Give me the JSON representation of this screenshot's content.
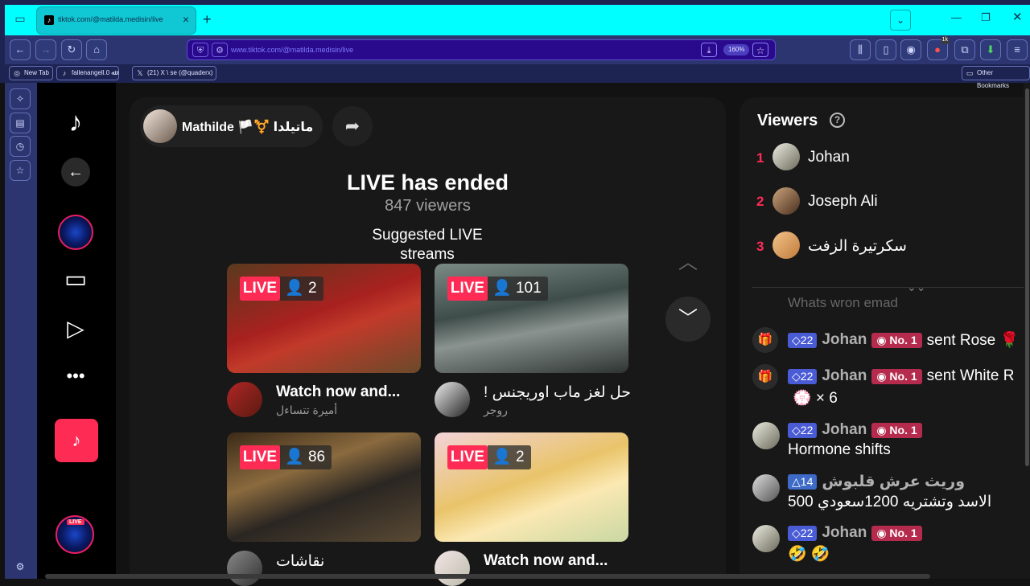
{
  "browser": {
    "tab_title": "tiktok.com/@matilda.medisin/live",
    "tab_close": "×",
    "new_tab": "+",
    "url": "www.tiktok.com/@matilda.medisin/live",
    "zoom": "160%",
    "bookmarks": [
      {
        "label": "New Tab",
        "icon": "globe-icon"
      },
      {
        "label": "fallenangell.0 ﷲ",
        "icon": "tiktok-icon"
      },
      {
        "label": "(21) X \\ se (@quaderx)",
        "icon": "x-icon"
      }
    ],
    "other_bookmarks": "Other Bookmarks",
    "badge_count": "1k"
  },
  "host": {
    "name": "Mathilde 🏳️⚧️ ماتيلدا"
  },
  "main": {
    "ended_title": "LIVE has ended",
    "viewers_text": "847 viewers",
    "suggested_title": "Suggested LIVE streams"
  },
  "suggested": [
    {
      "badge": "LIVE",
      "count": "2",
      "title": "Watch now and...",
      "subtitle": "أميرة تتساءل",
      "thumb": "#7a2a1e"
    },
    {
      "badge": "LIVE",
      "count": "101",
      "title": "! حل لغز ماب اوريجنس",
      "subtitle": "روجر",
      "thumb": "#5d6a6a"
    },
    {
      "badge": "LIVE",
      "count": "86",
      "title": "نقاشات",
      "subtitle": "",
      "thumb": "#6b4a2b"
    },
    {
      "badge": "LIVE",
      "count": "2",
      "title": "Watch now and...",
      "subtitle": "",
      "thumb": "#e6d7a9"
    }
  ],
  "viewers_panel": {
    "title": "Viewers",
    "help": "?",
    "top": [
      {
        "rank": "1",
        "name": "Johan"
      },
      {
        "rank": "2",
        "name": "Joseph Ali"
      },
      {
        "rank": "3",
        "name": "سكرتيرة الزفت"
      }
    ],
    "faded_line": "Whats wron emad"
  },
  "chat": [
    {
      "type": "gift",
      "level": "22",
      "name": "Johan",
      "rank": "No. 1",
      "message": "sent Rose 🌹",
      "extra": ""
    },
    {
      "type": "gift",
      "level": "22",
      "name": "Johan",
      "rank": "No. 1",
      "message": "sent White R",
      "extra": "💮 × 6"
    },
    {
      "type": "comment",
      "level": "22",
      "name": "Johan",
      "rank": "No. 1",
      "message": "Hormone shifts"
    },
    {
      "type": "comment",
      "level": "14",
      "name": "وريث عرش قلبوش",
      "rank": "",
      "message": "الاسد وتشتريه 1200سعودي 500"
    },
    {
      "type": "comment",
      "level": "22",
      "name": "Johan",
      "rank": "No. 1",
      "message": "🤣 🤣"
    }
  ],
  "colors": {
    "accent": "#fe2c55",
    "browser_tab": "#00ffff",
    "browser_bar": "#2c356f"
  }
}
